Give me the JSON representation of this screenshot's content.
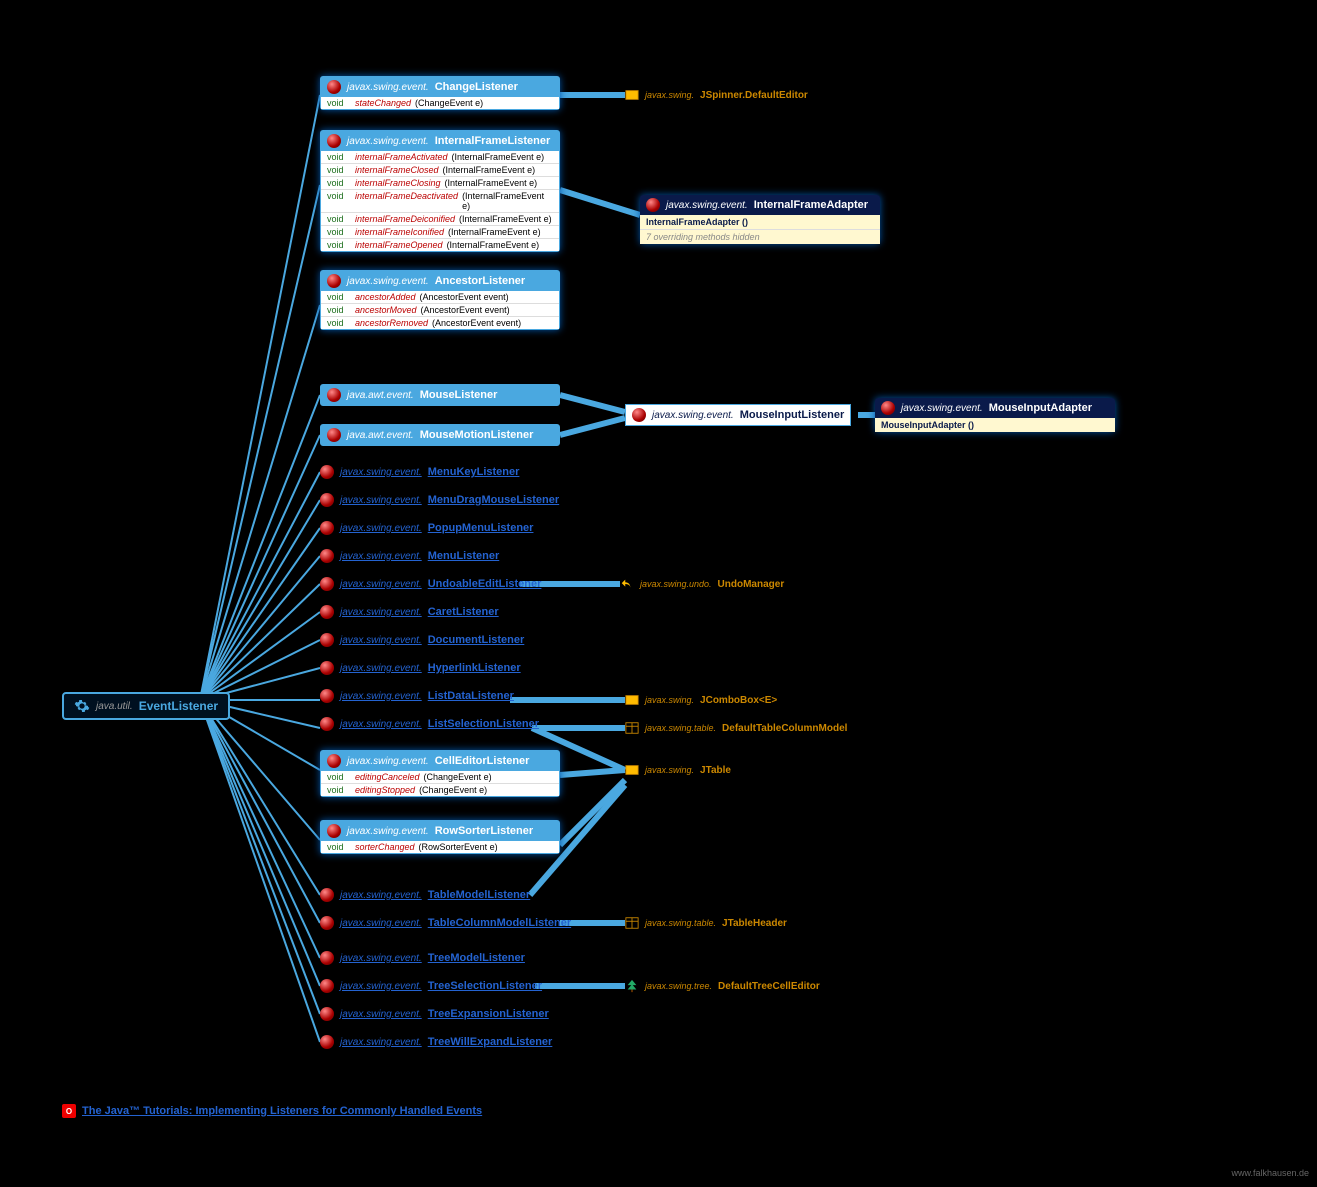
{
  "root": {
    "pkg": "java.util.",
    "name": "EventListener"
  },
  "changeListener": {
    "pkg": "javax.swing.event.",
    "name": "ChangeListener",
    "methods": [
      {
        "rt": "void",
        "mn": "stateChanged",
        "ag": "(ChangeEvent e)"
      }
    ]
  },
  "jspinner": {
    "pkg": "javax.swing.",
    "name": "JSpinner.DefaultEditor"
  },
  "ifl": {
    "pkg": "javax.swing.event.",
    "name": "InternalFrameListener",
    "methods": [
      {
        "rt": "void",
        "mn": "internalFrameActivated",
        "ag": "(InternalFrameEvent e)"
      },
      {
        "rt": "void",
        "mn": "internalFrameClosed",
        "ag": "(InternalFrameEvent e)"
      },
      {
        "rt": "void",
        "mn": "internalFrameClosing",
        "ag": "(InternalFrameEvent e)"
      },
      {
        "rt": "void",
        "mn": "internalFrameDeactivated",
        "ag": "(InternalFrameEvent e)"
      },
      {
        "rt": "void",
        "mn": "internalFrameDeiconified",
        "ag": "(InternalFrameEvent e)"
      },
      {
        "rt": "void",
        "mn": "internalFrameIconified",
        "ag": "(InternalFrameEvent e)"
      },
      {
        "rt": "void",
        "mn": "internalFrameOpened",
        "ag": "(InternalFrameEvent e)"
      }
    ]
  },
  "ifa": {
    "pkg": "javax.swing.event.",
    "name": "InternalFrameAdapter",
    "ctor": "InternalFrameAdapter ()",
    "note": "7 overriding methods hidden"
  },
  "anc": {
    "pkg": "javax.swing.event.",
    "name": "AncestorListener",
    "methods": [
      {
        "rt": "void",
        "mn": "ancestorAdded",
        "ag": "(AncestorEvent event)"
      },
      {
        "rt": "void",
        "mn": "ancestorMoved",
        "ag": "(AncestorEvent event)"
      },
      {
        "rt": "void",
        "mn": "ancestorRemoved",
        "ag": "(AncestorEvent event)"
      }
    ]
  },
  "ml": {
    "pkg": "java.awt.event.",
    "name": "MouseListener"
  },
  "mml": {
    "pkg": "java.awt.event.",
    "name": "MouseMotionListener"
  },
  "mil": {
    "pkg": "javax.swing.event.",
    "name": "MouseInputListener"
  },
  "mia": {
    "pkg": "javax.swing.event.",
    "name": "MouseInputAdapter",
    "ctor": "MouseInputAdapter ()"
  },
  "links": [
    {
      "pkg": "javax.swing.event.",
      "name": "MenuKeyListener"
    },
    {
      "pkg": "javax.swing.event.",
      "name": "MenuDragMouseListener"
    },
    {
      "pkg": "javax.swing.event.",
      "name": "PopupMenuListener"
    },
    {
      "pkg": "javax.swing.event.",
      "name": "MenuListener"
    },
    {
      "pkg": "javax.swing.event.",
      "name": "UndoableEditListener"
    },
    {
      "pkg": "javax.swing.event.",
      "name": "CaretListener"
    },
    {
      "pkg": "javax.swing.event.",
      "name": "DocumentListener"
    },
    {
      "pkg": "javax.swing.event.",
      "name": "HyperlinkListener"
    },
    {
      "pkg": "javax.swing.event.",
      "name": "ListDataListener"
    },
    {
      "pkg": "javax.swing.event.",
      "name": "ListSelectionListener"
    }
  ],
  "undo": {
    "pkg": "javax.swing.undo.",
    "name": "UndoManager"
  },
  "jcombo": {
    "pkg": "javax.swing.",
    "name": "JComboBox<E>"
  },
  "dtcm": {
    "pkg": "javax.swing.table.",
    "name": "DefaultTableColumnModel"
  },
  "cel": {
    "pkg": "javax.swing.event.",
    "name": "CellEditorListener",
    "methods": [
      {
        "rt": "void",
        "mn": "editingCanceled",
        "ag": "(ChangeEvent e)"
      },
      {
        "rt": "void",
        "mn": "editingStopped",
        "ag": "(ChangeEvent e)"
      }
    ]
  },
  "jtable": {
    "pkg": "javax.swing.",
    "name": "JTable"
  },
  "rsl": {
    "pkg": "javax.swing.event.",
    "name": "RowSorterListener",
    "methods": [
      {
        "rt": "void",
        "mn": "sorterChanged",
        "ag": "(RowSorterEvent e)"
      }
    ]
  },
  "links2": [
    {
      "pkg": "javax.swing.event.",
      "name": "TableModelListener"
    },
    {
      "pkg": "javax.swing.event.",
      "name": "TableColumnModelListener"
    }
  ],
  "jth": {
    "pkg": "javax.swing.table.",
    "name": "JTableHeader"
  },
  "links3": [
    {
      "pkg": "javax.swing.event.",
      "name": "TreeModelListener"
    },
    {
      "pkg": "javax.swing.event.",
      "name": "TreeSelectionListener"
    },
    {
      "pkg": "javax.swing.event.",
      "name": "TreeExpansionListener"
    },
    {
      "pkg": "javax.swing.event.",
      "name": "TreeWillExpandListener"
    }
  ],
  "dtce": {
    "pkg": "javax.swing.tree.",
    "name": "DefaultTreeCellEditor"
  },
  "footer": {
    "label": "The Java™ Tutorials: Implementing Listeners for Commonly Handled Events"
  },
  "credit": "www.falkhausen.de"
}
